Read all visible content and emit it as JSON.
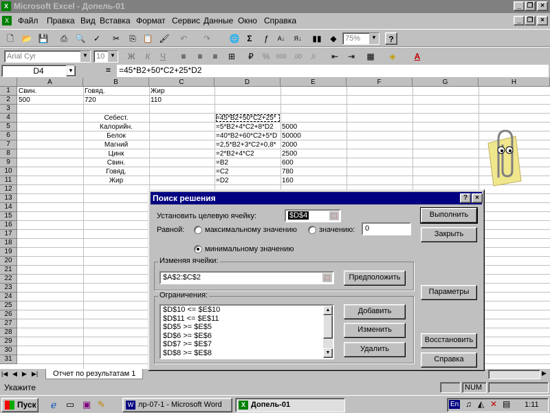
{
  "window": {
    "title": "Microsoft Excel - Допель-01"
  },
  "menu": [
    "Файл",
    "Правка",
    "Вид",
    "Вставка",
    "Формат",
    "Сервис",
    "Данные",
    "Окно",
    "Справка"
  ],
  "toolbar": {
    "zoom": "75%",
    "font": "Arial Cyr",
    "size": "10",
    "bold": "Ж",
    "italic": "К",
    "underline": "Ч",
    "percent": "%",
    "thousands": "000",
    "dec_inc": ",00",
    "dec_dec": ",0"
  },
  "formula_bar": {
    "name_box": "D4",
    "eq": "=",
    "formula": "=45*B2+50*C2+25*D2"
  },
  "columns": [
    "A",
    "B",
    "C",
    "D",
    "E",
    "F",
    "G",
    "H"
  ],
  "rows": [
    "1",
    "2",
    "3",
    "4",
    "5",
    "6",
    "7",
    "8",
    "9",
    "10",
    "11",
    "12",
    "13",
    "14",
    "15",
    "16",
    "17",
    "18",
    "19",
    "20",
    "21",
    "22",
    "23",
    "24",
    "25",
    "26",
    "27",
    "28",
    "29",
    "30",
    "31"
  ],
  "cells": {
    "r1": [
      "Свин.",
      "Говяд.",
      "Жир"
    ],
    "r2": [
      "500",
      "720",
      "110"
    ],
    "labels": [
      "Себест.",
      "Калорийн.",
      "Белок",
      "Магний",
      "Цинк",
      "Свин.",
      "Говяд.",
      "Жир"
    ],
    "formulas": [
      "=45*B2+50*C2+25*",
      "=5*B2+4*C2+8*D2",
      "=40*B2+60*C2+5*D",
      "=2,5*B2+3*C2+0,8*",
      "=2*B2+4*C2",
      "=B2",
      "=C2",
      "=D2"
    ],
    "limits": [
      "",
      "5000",
      "50000",
      "2000",
      "2500",
      "600",
      "780",
      "160"
    ]
  },
  "sheet_tab": "Отчет по результатам 1",
  "status": {
    "text": "Укажите",
    "num": "NUM"
  },
  "taskbar": {
    "start": "Пуск",
    "items": [
      "лр-07-1 - Microsoft Word",
      "Допель-01"
    ],
    "lang": "En",
    "clock": "1:11"
  },
  "dialog": {
    "title": "Поиск решения",
    "target_label": "Установить целевую ячейку:",
    "target_value": "$D$4",
    "equal_label": "Равной:",
    "opt_max": "максимальному значению",
    "opt_value": "значению:",
    "value_input": "0",
    "opt_min": "минимальному значению",
    "changing_label": "Изменяя ячейки:",
    "changing_value": "$A$2:$C$2",
    "guess_btn": "Предположить",
    "constraints_label": "Ограничения:",
    "constraints": [
      "$D$10 <= $E$10",
      "$D$11 <= $E$11",
      "$D$5 >= $E$5",
      "$D$6 >= $E$6",
      "$D$7 >= $E$7",
      "$D$8 >= $E$8"
    ],
    "add_btn": "Добавить",
    "change_btn": "Изменить",
    "delete_btn": "Удалить",
    "solve_btn": "Выполнить",
    "close_btn": "Закрыть",
    "options_btn": "Параметры",
    "reset_btn": "Восстановить",
    "help_btn": "Справка"
  }
}
